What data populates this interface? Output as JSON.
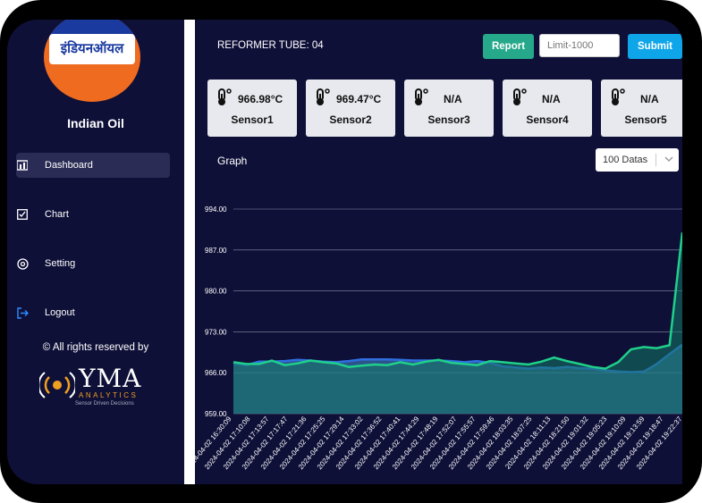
{
  "app": {
    "brand_logo_text": "इंडियनऑयल",
    "brand_name": "Indian Oil",
    "copyright": "© All rights reserved by",
    "partner_logo": {
      "word": "YMA",
      "sub": "ANALYTICS",
      "tagline": "Sensor Driven Decisions"
    }
  },
  "sidebar": {
    "items": [
      {
        "label": "Dashboard",
        "icon": "dashboard-icon",
        "active": true
      },
      {
        "label": "Chart",
        "icon": "chart-icon"
      },
      {
        "label": "Setting",
        "icon": "settings-icon"
      },
      {
        "label": "Logout",
        "icon": "logout-icon"
      }
    ]
  },
  "header": {
    "title": "REFORMER TUBE: 04",
    "report_label": "Report",
    "limit_placeholder": "Limit-1000",
    "submit_label": "Submit"
  },
  "sensors": [
    {
      "name": "Sensor1",
      "value": "966.98°C"
    },
    {
      "name": "Sensor2",
      "value": "969.47°C"
    },
    {
      "name": "Sensor3",
      "value": "N/A"
    },
    {
      "name": "Sensor4",
      "value": "N/A"
    },
    {
      "name": "Sensor5",
      "value": "N/A"
    }
  ],
  "graph": {
    "title": "Graph",
    "select_value": "100 Datas"
  },
  "colors": {
    "bg": "#0f1038",
    "series1": "#2f6fe0",
    "series2": "#1fd08a",
    "report": "#26a88a",
    "submit": "#0ea5e9"
  },
  "chart_data": {
    "type": "area",
    "ylim": [
      959,
      994
    ],
    "yticks": [
      "994.00",
      "987.00",
      "980.00",
      "973.00",
      "966.00",
      "959.00"
    ],
    "x_labels": [
      "2024-04-02 16:30:09",
      "2024-04-02 17:10:08",
      "2024-04-02 17:13:57",
      "2024-04-02 17:17:47",
      "2024-04-02 17:21:36",
      "2024-04-02 17:25:25",
      "2024-04-02 17:29:14",
      "2024-04-02 17:33:02",
      "2024-04-02 17:36:52",
      "2024-04-02 17:40:41",
      "2024-04-02 17:44:29",
      "2024-04-02 17:48:19",
      "2024-04-02 17:52:07",
      "2024-04-02 17:55:57",
      "2024-04-02 17:59:46",
      "2024-04-02 18:03:35",
      "2024-04-02 18:07:25",
      "2024-04-02 18:11:13",
      "2024-04-02 18:21:50",
      "2024-04-02 19:01:32",
      "2024-04-02 19:05:23",
      "2024-04-02 19:10:09",
      "2024-04-02 19:13:59",
      "2024-04-02 19:18:47",
      "2024-04-02 19:22:37"
    ],
    "series": [
      {
        "values": [
          967.6,
          967.3,
          967.9,
          967.9,
          968.0,
          968.2,
          968.1,
          967.9,
          967.8,
          968.0,
          968.3,
          968.3,
          968.3,
          968.2,
          968.1,
          968.1,
          968.1,
          968.0,
          967.8,
          968.0,
          967.7,
          967.1,
          966.9,
          966.7,
          966.9,
          966.8,
          967.0,
          966.8,
          966.7,
          966.4,
          966.2,
          966.1,
          966.2,
          967.5,
          969.2,
          970.8
        ]
      },
      {
        "values": [
          967.8,
          967.5,
          967.5,
          968.1,
          967.3,
          967.6,
          968.1,
          967.8,
          967.6,
          967.0,
          967.2,
          967.4,
          967.3,
          967.8,
          967.4,
          967.9,
          968.2,
          967.7,
          967.5,
          967.3,
          968.0,
          967.8,
          967.6,
          967.4,
          967.9,
          968.6,
          968.0,
          967.5,
          967.0,
          966.7,
          967.8,
          970.0,
          970.4,
          970.2,
          970.7,
          990.0
        ]
      }
    ]
  }
}
